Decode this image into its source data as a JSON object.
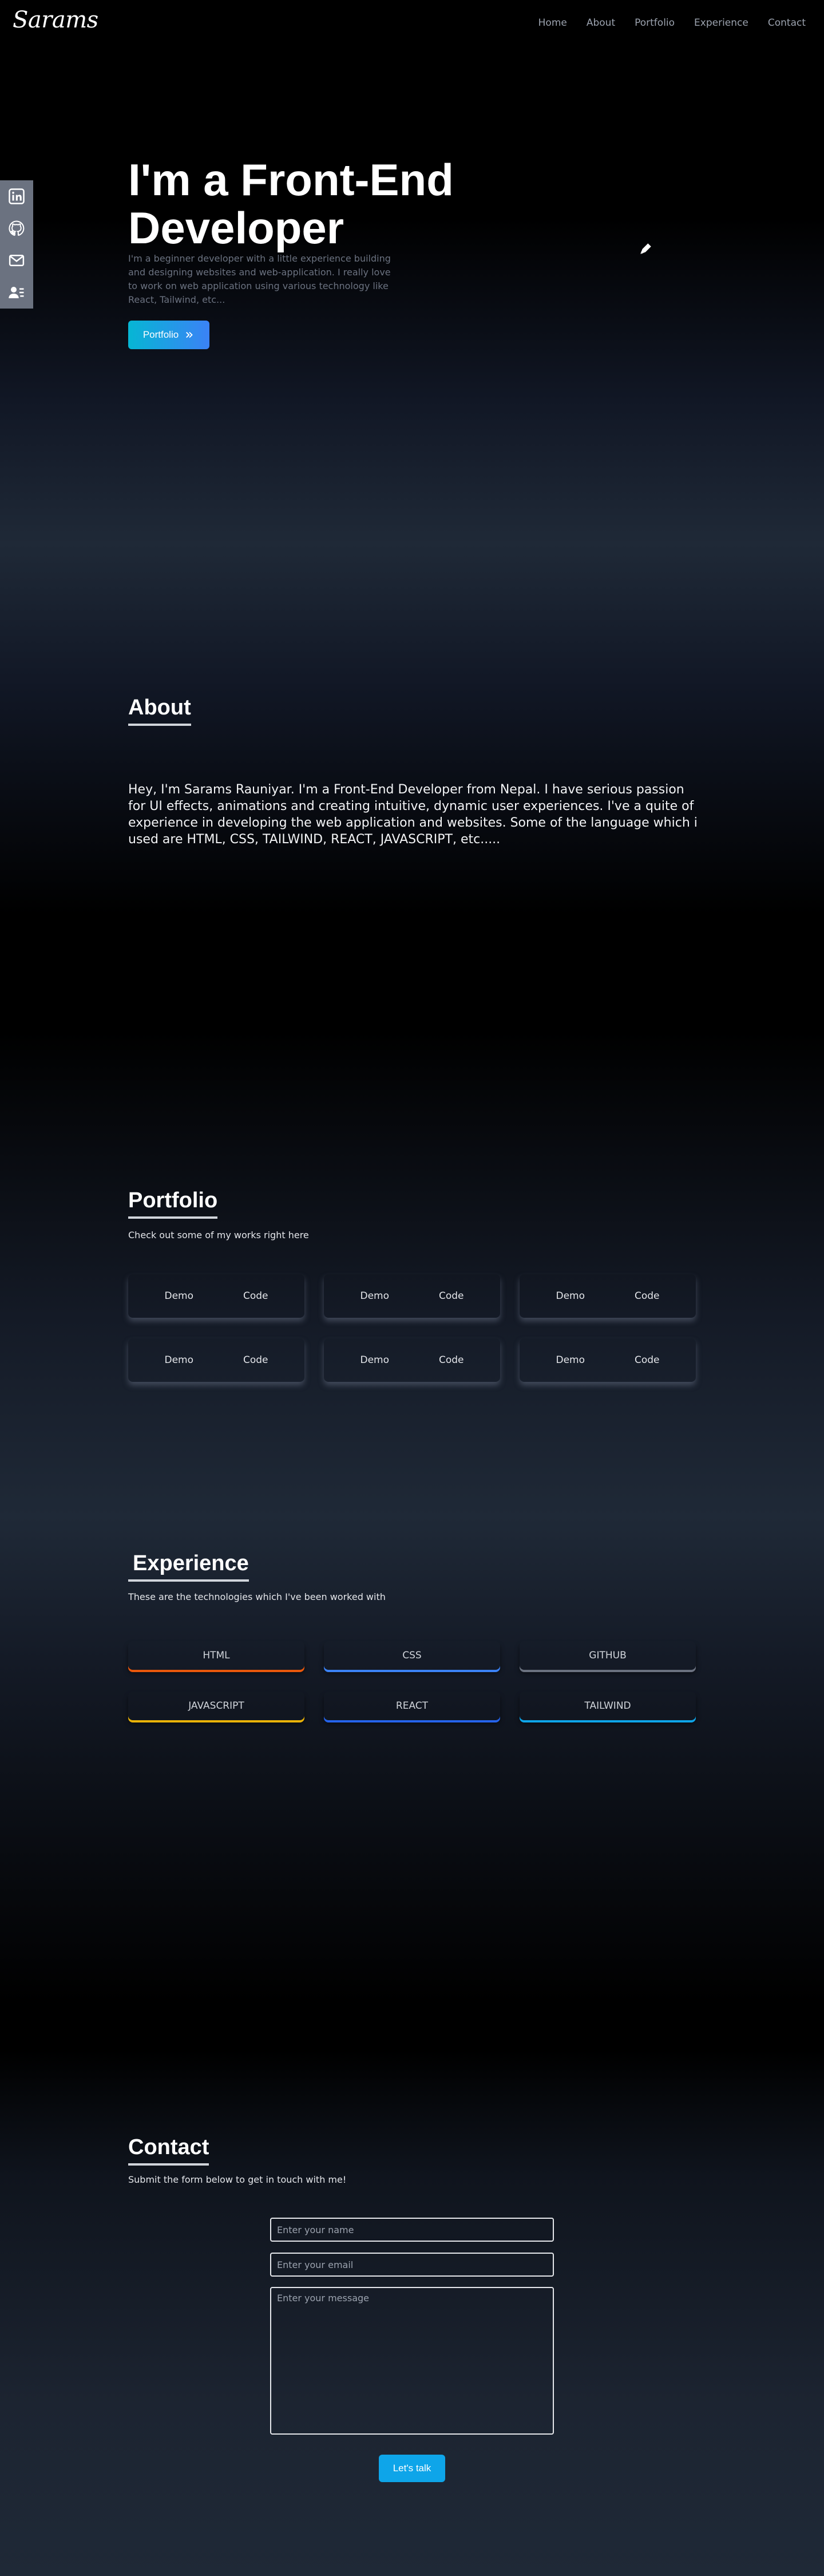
{
  "brand": {
    "logo": "Sarams"
  },
  "nav": {
    "links": [
      "Home",
      "About",
      "Portfolio",
      "Experience",
      "Contact"
    ]
  },
  "social": [
    "linkedin-icon",
    "github-icon",
    "mail-icon",
    "resume-icon"
  ],
  "hero": {
    "title": "I'm a Front-End Developer",
    "description": "I'm a beginner developer with a little experience building and designing websites and web-application. I really love to work on web application using various technology like React, Tailwind, etc...",
    "button_label": "Portfolio"
  },
  "about": {
    "title": "About",
    "text": "Hey, I'm Sarams Rauniyar. I'm a Front-End Developer from Nepal. I have serious passion for UI effects, animations and creating intuitive, dynamic user experiences. I've a quite of experience in developing the web application and websites. Some of the language which i used are HTML, CSS, TAILWIND, REACT, JAVASCRIPT, etc....."
  },
  "portfolio": {
    "title": "Portfolio",
    "subtitle": "Check out some of my works right here",
    "cards": [
      {
        "demo": "Demo",
        "code": "Code"
      },
      {
        "demo": "Demo",
        "code": "Code"
      },
      {
        "demo": "Demo",
        "code": "Code"
      },
      {
        "demo": "Demo",
        "code": "Code"
      },
      {
        "demo": "Demo",
        "code": "Code"
      },
      {
        "demo": "Demo",
        "code": "Code"
      }
    ]
  },
  "experience": {
    "title": "Experience",
    "subtitle": "These are the technologies which I've been worked with",
    "items": [
      {
        "label": "HTML",
        "color": "#ea580c"
      },
      {
        "label": "CSS",
        "color": "#3b82f6"
      },
      {
        "label": "GITHUB",
        "color": "#6b7280"
      },
      {
        "label": "JAVASCRIPT",
        "color": "#eab308"
      },
      {
        "label": "REACT",
        "color": "#2563eb"
      },
      {
        "label": "TAILWIND",
        "color": "#0ea5e9"
      }
    ]
  },
  "contact": {
    "title": "Contact",
    "subtitle": "Submit the form below to get in touch with me!",
    "name_placeholder": "Enter your name",
    "email_placeholder": "Enter your email",
    "message_placeholder": "Enter your message",
    "button_label": "Let's talk"
  }
}
